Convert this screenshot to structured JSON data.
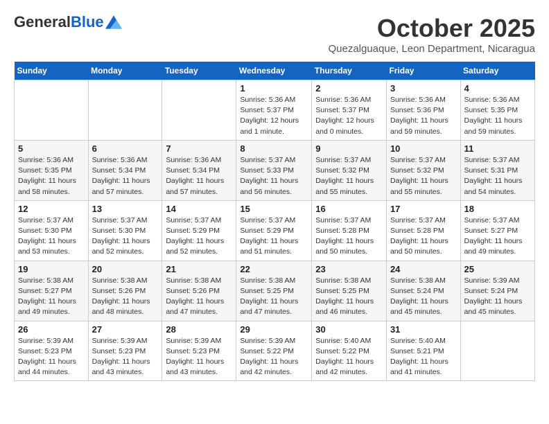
{
  "header": {
    "logo_general": "General",
    "logo_blue": "Blue",
    "month": "October 2025",
    "location": "Quezalguaque, Leon Department, Nicaragua"
  },
  "days_of_week": [
    "Sunday",
    "Monday",
    "Tuesday",
    "Wednesday",
    "Thursday",
    "Friday",
    "Saturday"
  ],
  "weeks": [
    [
      {
        "day": "",
        "info": ""
      },
      {
        "day": "",
        "info": ""
      },
      {
        "day": "",
        "info": ""
      },
      {
        "day": "1",
        "info": "Sunrise: 5:36 AM\nSunset: 5:37 PM\nDaylight: 12 hours\nand 1 minute."
      },
      {
        "day": "2",
        "info": "Sunrise: 5:36 AM\nSunset: 5:37 PM\nDaylight: 12 hours\nand 0 minutes."
      },
      {
        "day": "3",
        "info": "Sunrise: 5:36 AM\nSunset: 5:36 PM\nDaylight: 11 hours\nand 59 minutes."
      },
      {
        "day": "4",
        "info": "Sunrise: 5:36 AM\nSunset: 5:35 PM\nDaylight: 11 hours\nand 59 minutes."
      }
    ],
    [
      {
        "day": "5",
        "info": "Sunrise: 5:36 AM\nSunset: 5:35 PM\nDaylight: 11 hours\nand 58 minutes."
      },
      {
        "day": "6",
        "info": "Sunrise: 5:36 AM\nSunset: 5:34 PM\nDaylight: 11 hours\nand 57 minutes."
      },
      {
        "day": "7",
        "info": "Sunrise: 5:36 AM\nSunset: 5:34 PM\nDaylight: 11 hours\nand 57 minutes."
      },
      {
        "day": "8",
        "info": "Sunrise: 5:37 AM\nSunset: 5:33 PM\nDaylight: 11 hours\nand 56 minutes."
      },
      {
        "day": "9",
        "info": "Sunrise: 5:37 AM\nSunset: 5:32 PM\nDaylight: 11 hours\nand 55 minutes."
      },
      {
        "day": "10",
        "info": "Sunrise: 5:37 AM\nSunset: 5:32 PM\nDaylight: 11 hours\nand 55 minutes."
      },
      {
        "day": "11",
        "info": "Sunrise: 5:37 AM\nSunset: 5:31 PM\nDaylight: 11 hours\nand 54 minutes."
      }
    ],
    [
      {
        "day": "12",
        "info": "Sunrise: 5:37 AM\nSunset: 5:30 PM\nDaylight: 11 hours\nand 53 minutes."
      },
      {
        "day": "13",
        "info": "Sunrise: 5:37 AM\nSunset: 5:30 PM\nDaylight: 11 hours\nand 52 minutes."
      },
      {
        "day": "14",
        "info": "Sunrise: 5:37 AM\nSunset: 5:29 PM\nDaylight: 11 hours\nand 52 minutes."
      },
      {
        "day": "15",
        "info": "Sunrise: 5:37 AM\nSunset: 5:29 PM\nDaylight: 11 hours\nand 51 minutes."
      },
      {
        "day": "16",
        "info": "Sunrise: 5:37 AM\nSunset: 5:28 PM\nDaylight: 11 hours\nand 50 minutes."
      },
      {
        "day": "17",
        "info": "Sunrise: 5:37 AM\nSunset: 5:28 PM\nDaylight: 11 hours\nand 50 minutes."
      },
      {
        "day": "18",
        "info": "Sunrise: 5:37 AM\nSunset: 5:27 PM\nDaylight: 11 hours\nand 49 minutes."
      }
    ],
    [
      {
        "day": "19",
        "info": "Sunrise: 5:38 AM\nSunset: 5:27 PM\nDaylight: 11 hours\nand 49 minutes."
      },
      {
        "day": "20",
        "info": "Sunrise: 5:38 AM\nSunset: 5:26 PM\nDaylight: 11 hours\nand 48 minutes."
      },
      {
        "day": "21",
        "info": "Sunrise: 5:38 AM\nSunset: 5:26 PM\nDaylight: 11 hours\nand 47 minutes."
      },
      {
        "day": "22",
        "info": "Sunrise: 5:38 AM\nSunset: 5:25 PM\nDaylight: 11 hours\nand 47 minutes."
      },
      {
        "day": "23",
        "info": "Sunrise: 5:38 AM\nSunset: 5:25 PM\nDaylight: 11 hours\nand 46 minutes."
      },
      {
        "day": "24",
        "info": "Sunrise: 5:38 AM\nSunset: 5:24 PM\nDaylight: 11 hours\nand 45 minutes."
      },
      {
        "day": "25",
        "info": "Sunrise: 5:39 AM\nSunset: 5:24 PM\nDaylight: 11 hours\nand 45 minutes."
      }
    ],
    [
      {
        "day": "26",
        "info": "Sunrise: 5:39 AM\nSunset: 5:23 PM\nDaylight: 11 hours\nand 44 minutes."
      },
      {
        "day": "27",
        "info": "Sunrise: 5:39 AM\nSunset: 5:23 PM\nDaylight: 11 hours\nand 43 minutes."
      },
      {
        "day": "28",
        "info": "Sunrise: 5:39 AM\nSunset: 5:23 PM\nDaylight: 11 hours\nand 43 minutes."
      },
      {
        "day": "29",
        "info": "Sunrise: 5:39 AM\nSunset: 5:22 PM\nDaylight: 11 hours\nand 42 minutes."
      },
      {
        "day": "30",
        "info": "Sunrise: 5:40 AM\nSunset: 5:22 PM\nDaylight: 11 hours\nand 42 minutes."
      },
      {
        "day": "31",
        "info": "Sunrise: 5:40 AM\nSunset: 5:21 PM\nDaylight: 11 hours\nand 41 minutes."
      },
      {
        "day": "",
        "info": ""
      }
    ]
  ]
}
